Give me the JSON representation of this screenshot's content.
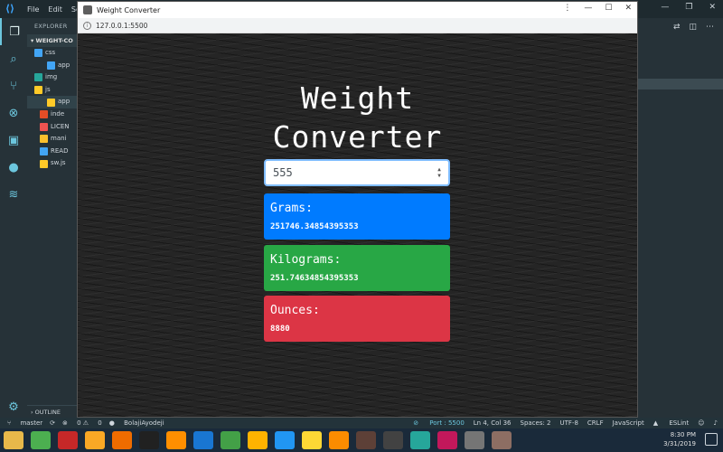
{
  "vscode": {
    "menu": [
      "File",
      "Edit",
      "Sel"
    ],
    "explorer_label": "EXPLORER",
    "project_label": "WEIGHT-CO",
    "tree": [
      {
        "label": "css",
        "icon": "folder-icon",
        "color": "#42a5f5",
        "indent": 8,
        "sel": false
      },
      {
        "label": "app",
        "icon": "css-file-icon",
        "color": "#42a5f5",
        "indent": 22,
        "sel": false
      },
      {
        "label": "img",
        "icon": "folder-icon",
        "color": "#26a69a",
        "indent": 8,
        "sel": false
      },
      {
        "label": "js",
        "icon": "folder-icon",
        "color": "#ffca28",
        "indent": 8,
        "sel": false
      },
      {
        "label": "app",
        "icon": "js-file-icon",
        "color": "#ffca28",
        "indent": 22,
        "sel": true
      },
      {
        "label": "inde",
        "icon": "html-file-icon",
        "color": "#e44d26",
        "indent": 14,
        "sel": false
      },
      {
        "label": "LICEN",
        "icon": "license-file-icon",
        "color": "#ef5350",
        "indent": 14,
        "sel": false
      },
      {
        "label": "mani",
        "icon": "json-file-icon",
        "color": "#fbc02d",
        "indent": 14,
        "sel": false
      },
      {
        "label": "READ",
        "icon": "markdown-file-icon",
        "color": "#42a5f5",
        "indent": 14,
        "sel": false
      },
      {
        "label": "sw.js",
        "icon": "js-file-icon",
        "color": "#ffca28",
        "indent": 14,
        "sel": false
      }
    ],
    "outline_label": "OUTLINE",
    "status": {
      "branch": "master",
      "errors": "0",
      "warnings": "0",
      "user": "BolajiAyodeji",
      "port": "Port : 5500",
      "position": "Ln 4, Col 36",
      "spaces": "Spaces: 2",
      "encoding": "UTF-8",
      "eol": "CRLF",
      "language": "JavaScript",
      "linter": "ESLint"
    }
  },
  "browser": {
    "window_title": "Weight Converter",
    "url": "127.0.0.1:5500"
  },
  "app": {
    "title_line1": "Weight",
    "title_line2": "Converter",
    "input_value": "555",
    "grams": {
      "label": "Grams:",
      "value": "251746.34854395353",
      "color": "#007bff"
    },
    "kilograms": {
      "label": "Kilograms:",
      "value": "251.74634854395353",
      "color": "#28a745"
    },
    "ounces": {
      "label": "Ounces:",
      "value": "8880",
      "color": "#dc3545"
    }
  },
  "taskbar": {
    "apps": [
      {
        "name": "file-explorer-icon",
        "color": "#e8b84a"
      },
      {
        "name": "home-icon",
        "color": "#4caf50"
      },
      {
        "name": "filezilla-icon",
        "color": "#c62828"
      },
      {
        "name": "app-icon",
        "color": "#f9a825"
      },
      {
        "name": "xampp-icon",
        "color": "#ef6c00"
      },
      {
        "name": "terminal-icon",
        "color": "#212121"
      },
      {
        "name": "vlc-icon",
        "color": "#ff8f00"
      },
      {
        "name": "vscode-icon",
        "color": "#1976d2"
      },
      {
        "name": "chrome-icon",
        "color": "#43a047"
      },
      {
        "name": "app-icon",
        "color": "#ffb300"
      },
      {
        "name": "zoom-icon",
        "color": "#2196f3"
      },
      {
        "name": "app-icon",
        "color": "#fdd835"
      },
      {
        "name": "app-icon",
        "color": "#fb8c00"
      },
      {
        "name": "person-icon",
        "color": "#5d4037"
      },
      {
        "name": "app-icon",
        "color": "#424242"
      },
      {
        "name": "app-icon",
        "color": "#26a69a"
      },
      {
        "name": "instagram-icon",
        "color": "#c2185b"
      },
      {
        "name": "app-icon",
        "color": "#757575"
      },
      {
        "name": "app-icon",
        "color": "#8d6e63"
      }
    ],
    "time": "8:30 PM",
    "date": "3/31/2019"
  }
}
